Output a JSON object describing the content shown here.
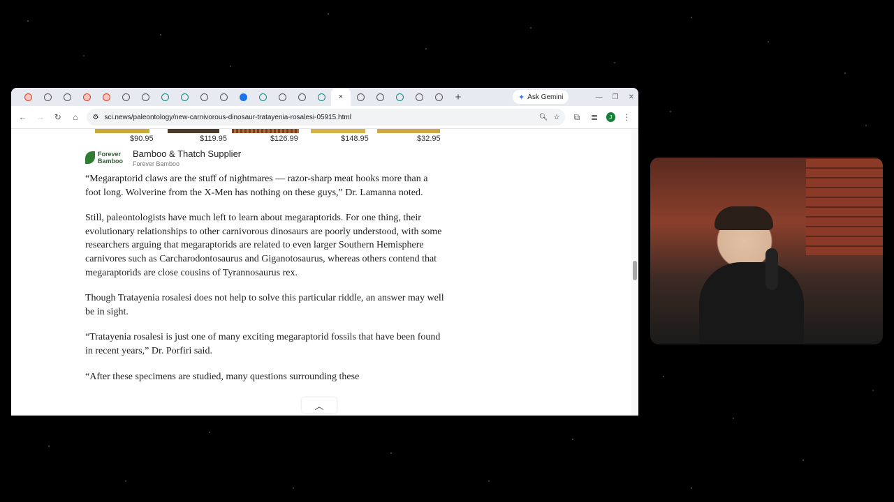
{
  "browser": {
    "tab_icons": [
      "red",
      "g",
      "g",
      "red",
      "red",
      "g",
      "g",
      "teal",
      "teal",
      "g",
      "g",
      "blue",
      "teal",
      "g",
      "g",
      "teal",
      "g",
      "g",
      "g",
      "teal",
      "g",
      "g"
    ],
    "active_tab_close": "×",
    "new_tab": "+",
    "ask_gemini": "Ask Gemini",
    "url": "sci.news/paleontology/new-carnivorous-dinosaur-tratayenia-rosalesi-05915.html",
    "avatar_letter": "J"
  },
  "ad": {
    "prices": [
      "$90.95",
      "$119.95",
      "$126.99",
      "$148.95",
      "$32.95"
    ],
    "logo_text": "Forever Bamboo",
    "name": "Bamboo & Thatch Supplier",
    "sub": "Forever Bamboo"
  },
  "article": {
    "p1": "“Megaraptorid claws are the stuff of nightmares — razor-sharp meat hooks more than a foot long. Wolverine from the X-Men has nothing on these guys,” Dr. Lamanna noted.",
    "p2": "Still, paleontologists have much left to learn about megaraptorids. For one thing, their evolutionary relationships to other carnivorous dinosaurs are poorly understood, with some researchers arguing that megaraptorids are related to even larger Southern Hemisphere carnivores such as Carcharodontosaurus and Giganotosaurus, whereas others contend that megaraptorids are close cousins of Tyrannosaurus rex.",
    "p3": "Though Tratayenia rosalesi does not help to solve this particular riddle, an answer may well be in sight.",
    "p4": "“Tratayenia rosalesi is just one of many exciting megaraptorid fossils that have been found in recent years,” Dr. Porfiri said.",
    "p5": "“After these specimens are studied, many questions surrounding these"
  },
  "colors": {
    "tabstrip": "#e7eaf0",
    "accent": "#1a73e8"
  }
}
